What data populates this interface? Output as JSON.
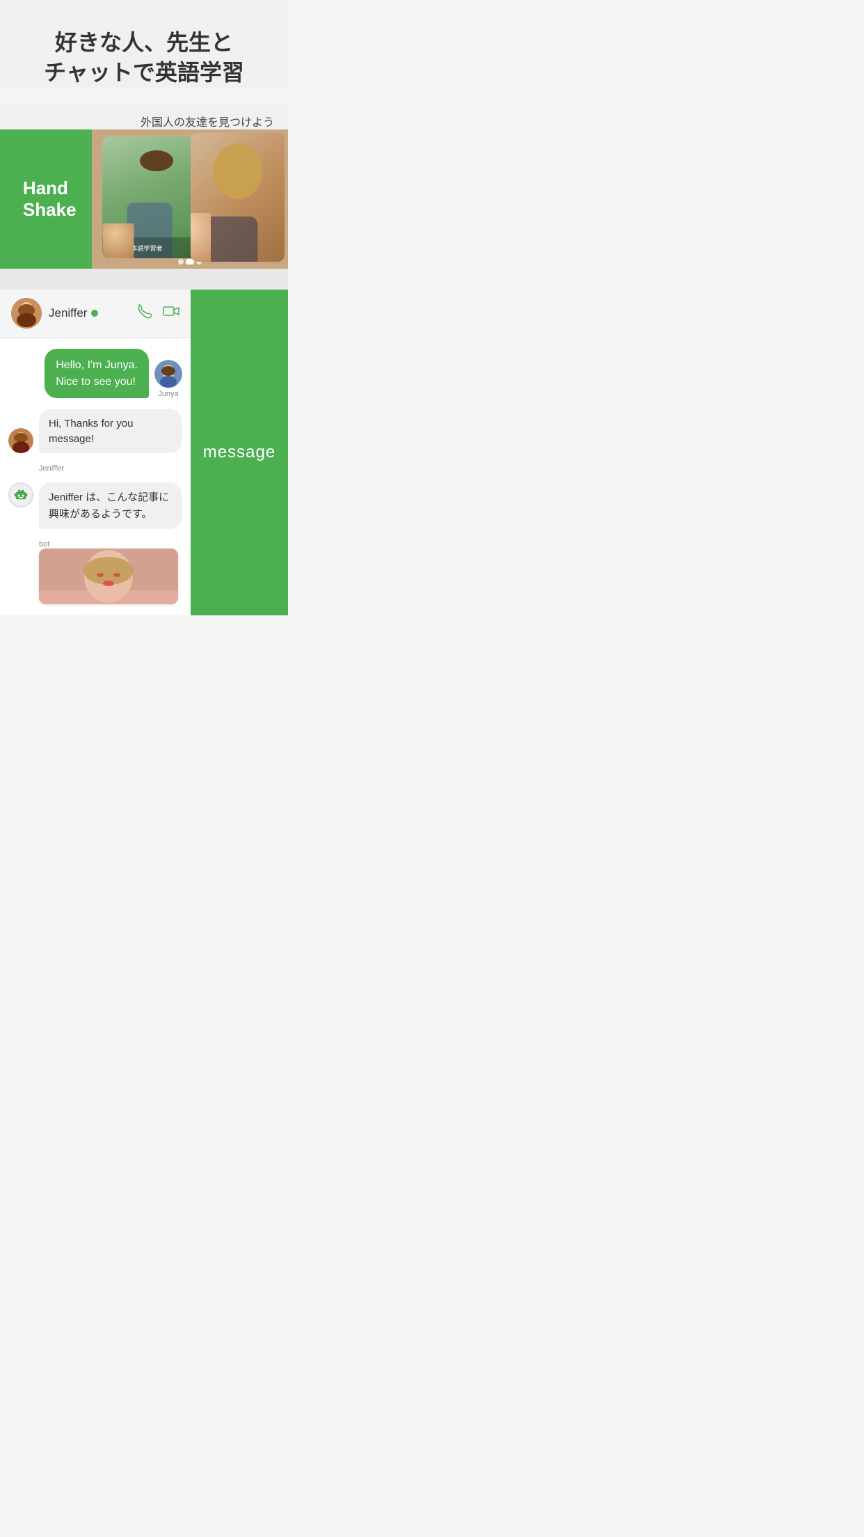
{
  "top": {
    "headline": "好きな人、先生と\nチャットで英語学習",
    "find_friends": "外国人の友達を見つけよう",
    "handshake_line1": "Hand",
    "handshake_line2": "Shake"
  },
  "chat": {
    "header": {
      "name": "Jeniffer",
      "online": true,
      "phone_icon": "📞",
      "video_icon": "📹"
    },
    "messages": [
      {
        "type": "out",
        "text": "Hello, I'm  Junya.\nNice to see you!",
        "sender": "Junya"
      },
      {
        "type": "in",
        "text": "Hi, Thanks for you message!",
        "sender": "Jeniffer"
      },
      {
        "type": "bot",
        "text": "Jeniffer は、こんな記事に興味があるようです。",
        "sender": "bot"
      }
    ],
    "right_label": "message"
  },
  "bot_label": "bot",
  "jeniffer_label": "Jeniffer",
  "junya_label": "Junya"
}
